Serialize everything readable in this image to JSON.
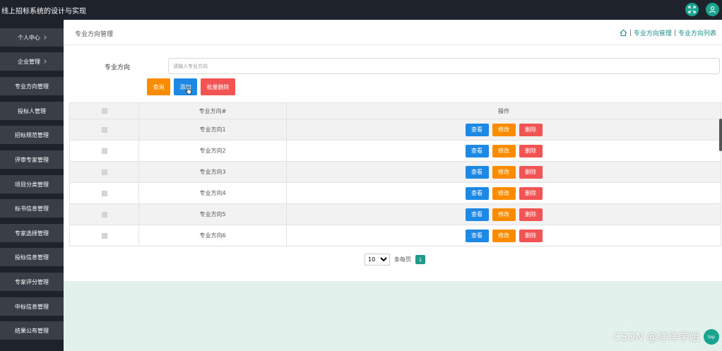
{
  "app": {
    "title": "线上招标系统的设计与实现"
  },
  "sidebar": {
    "items": [
      {
        "label": "个人中心",
        "chevron": true
      },
      {
        "label": "企业管理",
        "chevron": true
      },
      {
        "label": "专业方向管理"
      },
      {
        "label": "投标人管理"
      },
      {
        "label": "招标规范管理"
      },
      {
        "label": "评审专家管理"
      },
      {
        "label": "项目分类管理"
      },
      {
        "label": "标书信息管理"
      },
      {
        "label": "专家选择管理"
      },
      {
        "label": "投标信息管理"
      },
      {
        "label": "专家评分管理"
      },
      {
        "label": "中标信息管理"
      },
      {
        "label": "结果公布管理"
      }
    ]
  },
  "breadcrumb": {
    "title": "专业方向管理",
    "sep": "|",
    "path": [
      "专业方向管理",
      "专业方向列表"
    ]
  },
  "search": {
    "label": "专业方向",
    "placeholder": "请输入专业方向"
  },
  "toolbar": {
    "query_label": "查询",
    "add_label": "添加",
    "batch_delete_label": "批量删除"
  },
  "table": {
    "headers": [
      "",
      "专业方向#",
      "操作"
    ],
    "rows": [
      {
        "name": "专业方向1"
      },
      {
        "name": "专业方向2"
      },
      {
        "name": "专业方向3"
      },
      {
        "name": "专业方向4"
      },
      {
        "name": "专业方向5"
      },
      {
        "name": "专业方向6"
      }
    ],
    "actions": {
      "view": "查看",
      "edit": "修改",
      "delete": "删除"
    }
  },
  "pagination": {
    "page_size": "10",
    "per_page_label": "条每页",
    "current_page": "1"
  },
  "watermark": "CSDN @洋洋学姐",
  "back_to_top": "top",
  "colors": {
    "orange": "#fb8c00",
    "blue": "#1e88e5",
    "red": "#f25454",
    "teal": "#1aa38f",
    "dark": "#1e232b"
  }
}
